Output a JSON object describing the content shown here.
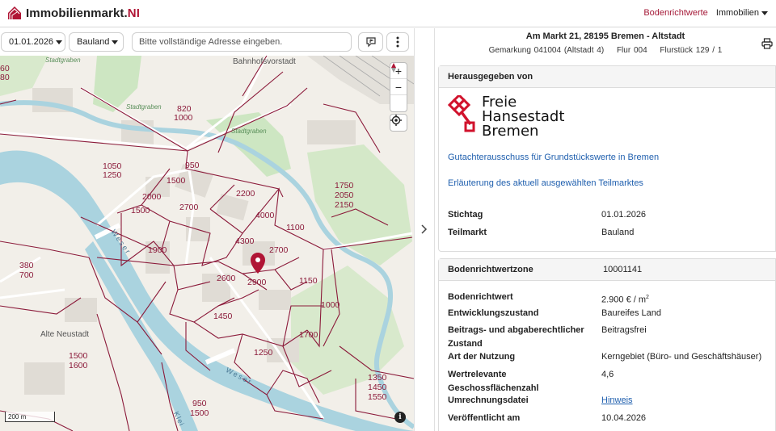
{
  "brand": {
    "name": "Immobilienmarkt.",
    "suffix": "NI"
  },
  "nav": {
    "active": "Bodenrichtwerte",
    "menu": "Immobilien"
  },
  "toolbar": {
    "date": "01.01.2026",
    "market": "Bauland",
    "address_placeholder": "Bitte vollständige Adresse eingeben."
  },
  "map": {
    "labels": {
      "stadtgraben_nw": "Stadtgraben",
      "stadtgraben_mid": "Stadtgraben",
      "stadtgraben_ne": "Stadtgraben",
      "bahnhofsvorstadt": "Bahnhofsvorstadt",
      "alte_neustadt": "Alte Neustadt",
      "weser_1": "Weser",
      "weser_2": "Weser",
      "kleine_weser": "Klei"
    },
    "values": [
      "820",
      "1000",
      "1050",
      "1250",
      "950",
      "1500",
      "2000",
      "2700",
      "2200",
      "1750",
      "2050",
      "2150",
      "1500",
      "4000",
      "1100",
      "4300",
      "2700",
      "1900",
      "380",
      "700",
      "2600",
      "2900",
      "1150",
      "1000",
      "1450",
      "1700",
      "1250",
      "1500",
      "1600",
      "1350",
      "1450",
      "1550",
      "950",
      "1500",
      "60",
      "80"
    ],
    "scale": "200 m",
    "info": "i"
  },
  "panel": {
    "address": "Am Markt 21, 28195 Bremen - Altstadt",
    "gemarkung": "Gemarkung 041004 (Altstadt 4)",
    "flur": "Flur 004",
    "flurstueck": "Flurstück 129 / 1",
    "issuer_header": "Herausgegeben von",
    "logo_lines": [
      "Freie",
      "Hansestadt",
      "Bremen"
    ],
    "committee_link": "Gutachterausschuss für Grundstückswerte in Bremen",
    "market_link": "Erläuterung des aktuell ausgewählten Teilmarktes",
    "stichtag_label": "Stichtag",
    "stichtag_value": "01.01.2026",
    "teilmarkt_label": "Teilmarkt",
    "teilmarkt_value": "Bauland",
    "zone_label": "Bodenrichtwertzone",
    "zone_value": "10001141",
    "rows": [
      {
        "label": "Bodenrichtwert",
        "value": "2.900 € / m",
        "sup": "2"
      },
      {
        "label": "Entwicklungszustand",
        "value": "Baureifes Land"
      },
      {
        "label": "Beitrags- und abgaberechtlicher Zustand",
        "value": "Beitragsfrei"
      },
      {
        "label": "Art der Nutzung",
        "value": "Kerngebiet (Büro- und Geschäftshäuser)"
      },
      {
        "label": "Wertrelevante Geschossflächenzahl",
        "value": "4,6"
      },
      {
        "label": "Umrechnungsdatei",
        "value": "Hinweis",
        "link": true
      },
      {
        "label": "Veröffentlicht am",
        "value": "10.04.2026"
      }
    ]
  },
  "colors": {
    "accent": "#a51a38",
    "link": "#1f5fae",
    "river": "#aad3df",
    "boundary": "#8b1a3a"
  }
}
